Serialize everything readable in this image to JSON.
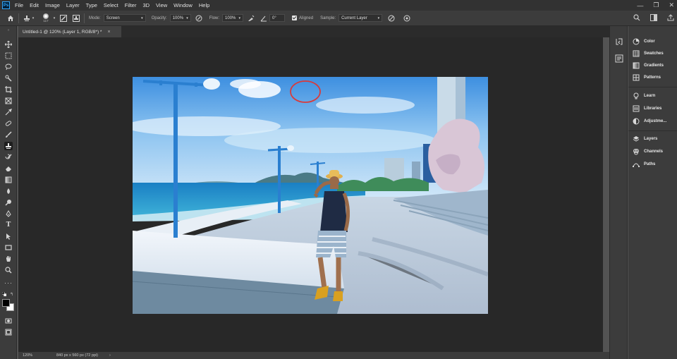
{
  "app": {
    "logo": "Ps"
  },
  "menu": [
    "File",
    "Edit",
    "Image",
    "Layer",
    "Type",
    "Select",
    "Filter",
    "3D",
    "View",
    "Window",
    "Help"
  ],
  "window_controls": {
    "minimize": "—",
    "restore": "❐",
    "close": "✕"
  },
  "options_bar": {
    "brush_size": "117",
    "mode_label": "Mode:",
    "mode_value": "Screen",
    "opacity_label": "Opacity:",
    "opacity_value": "100%",
    "flow_label": "Flow:",
    "flow_value": "100%",
    "angle_value": "0°",
    "aligned_label": "Aligned",
    "sample_label": "Sample:",
    "sample_value": "Current Layer"
  },
  "document_tab": {
    "title": "Untitled-1 @ 120% (Layer 1, RGB/8*) *",
    "close": "×"
  },
  "status_bar": {
    "zoom": "120%",
    "doc_info": "840 px x 560 px (72 ppi)",
    "arrow": "›"
  },
  "panels": [
    {
      "label": "Color",
      "icon": "color-icon"
    },
    {
      "label": "Swatches",
      "icon": "swatches-icon"
    },
    {
      "label": "Gradients",
      "icon": "gradients-icon"
    },
    {
      "label": "Patterns",
      "icon": "patterns-icon"
    },
    {
      "label": "Learn",
      "icon": "learn-icon"
    },
    {
      "label": "Libraries",
      "icon": "libraries-icon"
    },
    {
      "label": "Adjustme...",
      "icon": "adjustments-icon"
    },
    {
      "label": "Layers",
      "icon": "layers-icon"
    },
    {
      "label": "Channels",
      "icon": "channels-icon"
    },
    {
      "label": "Paths",
      "icon": "paths-icon"
    }
  ],
  "colors": {
    "accent": "#31a8ff",
    "brush_circle": "#d93a3a"
  }
}
